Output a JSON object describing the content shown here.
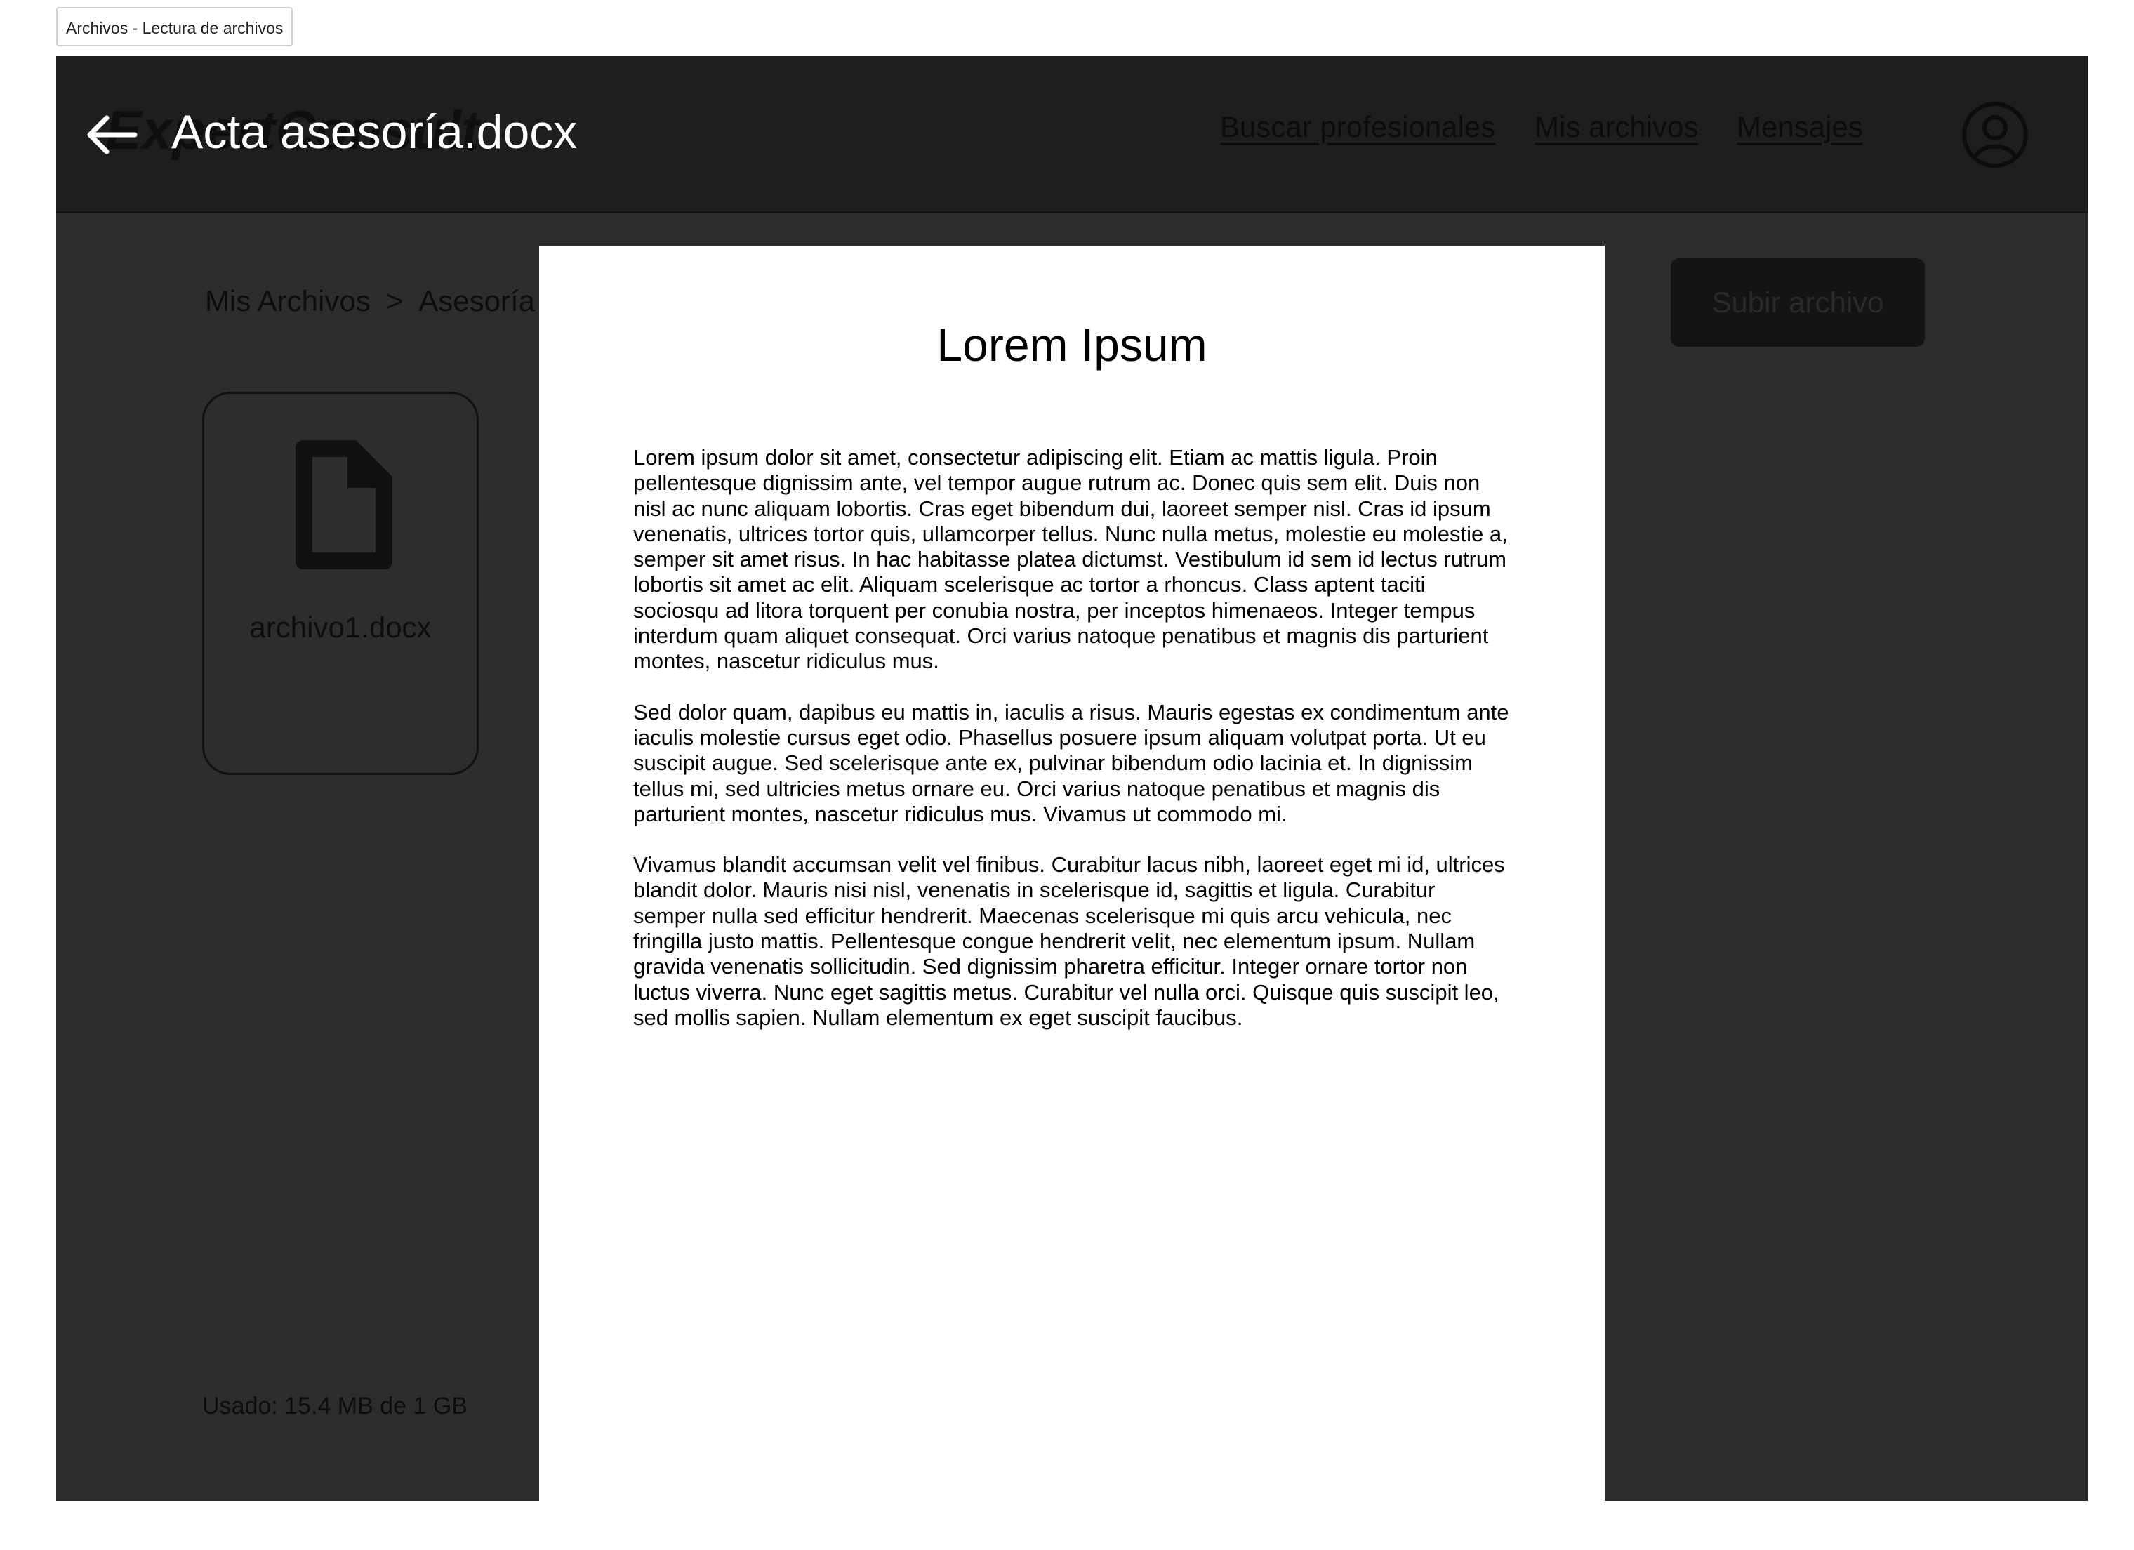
{
  "frame_label": "Archivos - Lectura de archivos",
  "header": {
    "brand": "ExpertConsult",
    "nav": [
      "Buscar profesionales",
      "Mis archivos",
      "Mensajes"
    ]
  },
  "breadcrumb": {
    "root": "Mis Archivos",
    "separator": ">",
    "current": "Asesoría"
  },
  "upload_button": "Subir archivo",
  "files": [
    {
      "name": "archivo1.docx",
      "icon": "document-icon"
    }
  ],
  "storage_usage": "Usado: 15.4 MB de 1 GB",
  "viewer": {
    "file_title": "Acta asesoría.docx",
    "back_icon": "arrow-left-icon",
    "heading": "Lorem Ipsum",
    "paragraphs": [
      "Lorem ipsum dolor sit amet, consectetur adipiscing elit. Etiam ac mattis ligula. Proin pellentesque dignissim ante, vel tempor augue rutrum ac. Donec quis sem elit. Duis non nisl ac nunc aliquam lobortis. Cras eget bibendum dui, laoreet semper nisl. Cras id ipsum venenatis, ultrices tortor quis, ullamcorper tellus. Nunc nulla metus, molestie eu molestie a, semper sit amet risus. In hac habitasse platea dictumst. Vestibulum id sem id lectus rutrum lobortis sit amet ac elit. Aliquam scelerisque ac tortor a rhoncus. Class aptent taciti sociosqu ad litora torquent per conubia nostra, per inceptos himenaeos. Integer tempus interdum quam aliquet consequat. Orci varius natoque penatibus et magnis dis parturient montes, nascetur ridiculus mus.",
      "Sed dolor quam, dapibus eu mattis in, iaculis a risus. Mauris egestas ex condimentum ante iaculis molestie cursus eget odio. Phasellus posuere ipsum aliquam volutpat porta. Ut eu suscipit augue. Sed scelerisque ante ex, pulvinar bibendum odio lacinia et. In dignissim tellus mi, sed ultricies metus ornare eu. Orci varius natoque penatibus et magnis dis parturient montes, nascetur ridiculus mus. Vivamus ut commodo mi.",
      "Vivamus blandit accumsan velit vel finibus. Curabitur lacus nibh, laoreet eget mi id, ultrices blandit dolor. Mauris nisi nisl, venenatis in scelerisque id, sagittis et ligula. Curabitur semper nulla sed efficitur hendrerit. Maecenas scelerisque mi quis arcu vehicula, nec fringilla justo mattis. Pellentesque congue hendrerit velit, nec elementum ipsum. Nullam gravida venenatis sollicitudin. Sed dignissim pharetra efficitur. Integer ornare tortor non luctus viverra. Nunc eget sagittis metus. Curabitur vel nulla orci. Quisque quis suscipit leo, sed mollis sapien. Nullam elementum ex eget suscipit faucibus."
    ]
  },
  "icons": {
    "user": "user-circle-icon"
  },
  "colors": {
    "overlay_background": "#2d2d2d",
    "topbar_background": "#1e1e1e",
    "document_page": "#ffffff",
    "title_text": "#ffffff"
  }
}
